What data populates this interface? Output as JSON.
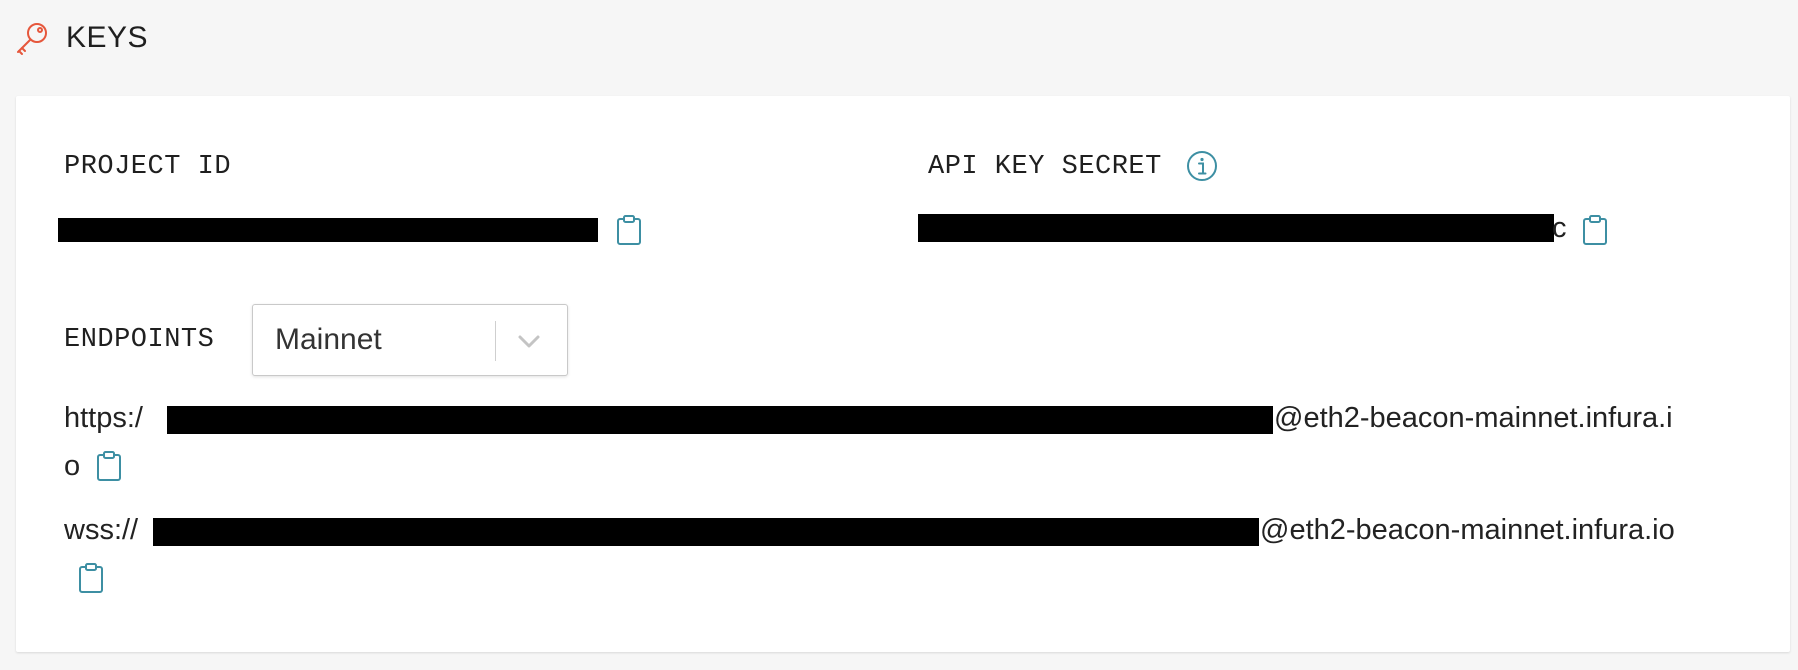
{
  "header": {
    "icon": "key-icon",
    "title": "KEYS",
    "accent_color": "#e6573c"
  },
  "project_id": {
    "label": "PROJECT ID",
    "copy_icon": "clipboard-icon"
  },
  "api_key_secret": {
    "label": "API KEY SECRET",
    "info_icon": "info-icon",
    "visible_tail": "c",
    "copy_icon": "clipboard-icon"
  },
  "endpoints": {
    "label": "ENDPOINTS",
    "network_select": {
      "value": "Mainnet",
      "icon": "chevron-down-icon"
    },
    "https": {
      "prefix": "https:/",
      "suffix": "@eth2-beacon-mainnet.infura.i",
      "wrap": "o"
    },
    "wss": {
      "prefix": "wss://",
      "suffix": "@eth2-beacon-mainnet.infura.io"
    }
  },
  "colors": {
    "icon_teal": "#3d8fa3",
    "redaction": "#000000",
    "card_bg": "#ffffff",
    "page_bg": "#f6f6f6"
  }
}
